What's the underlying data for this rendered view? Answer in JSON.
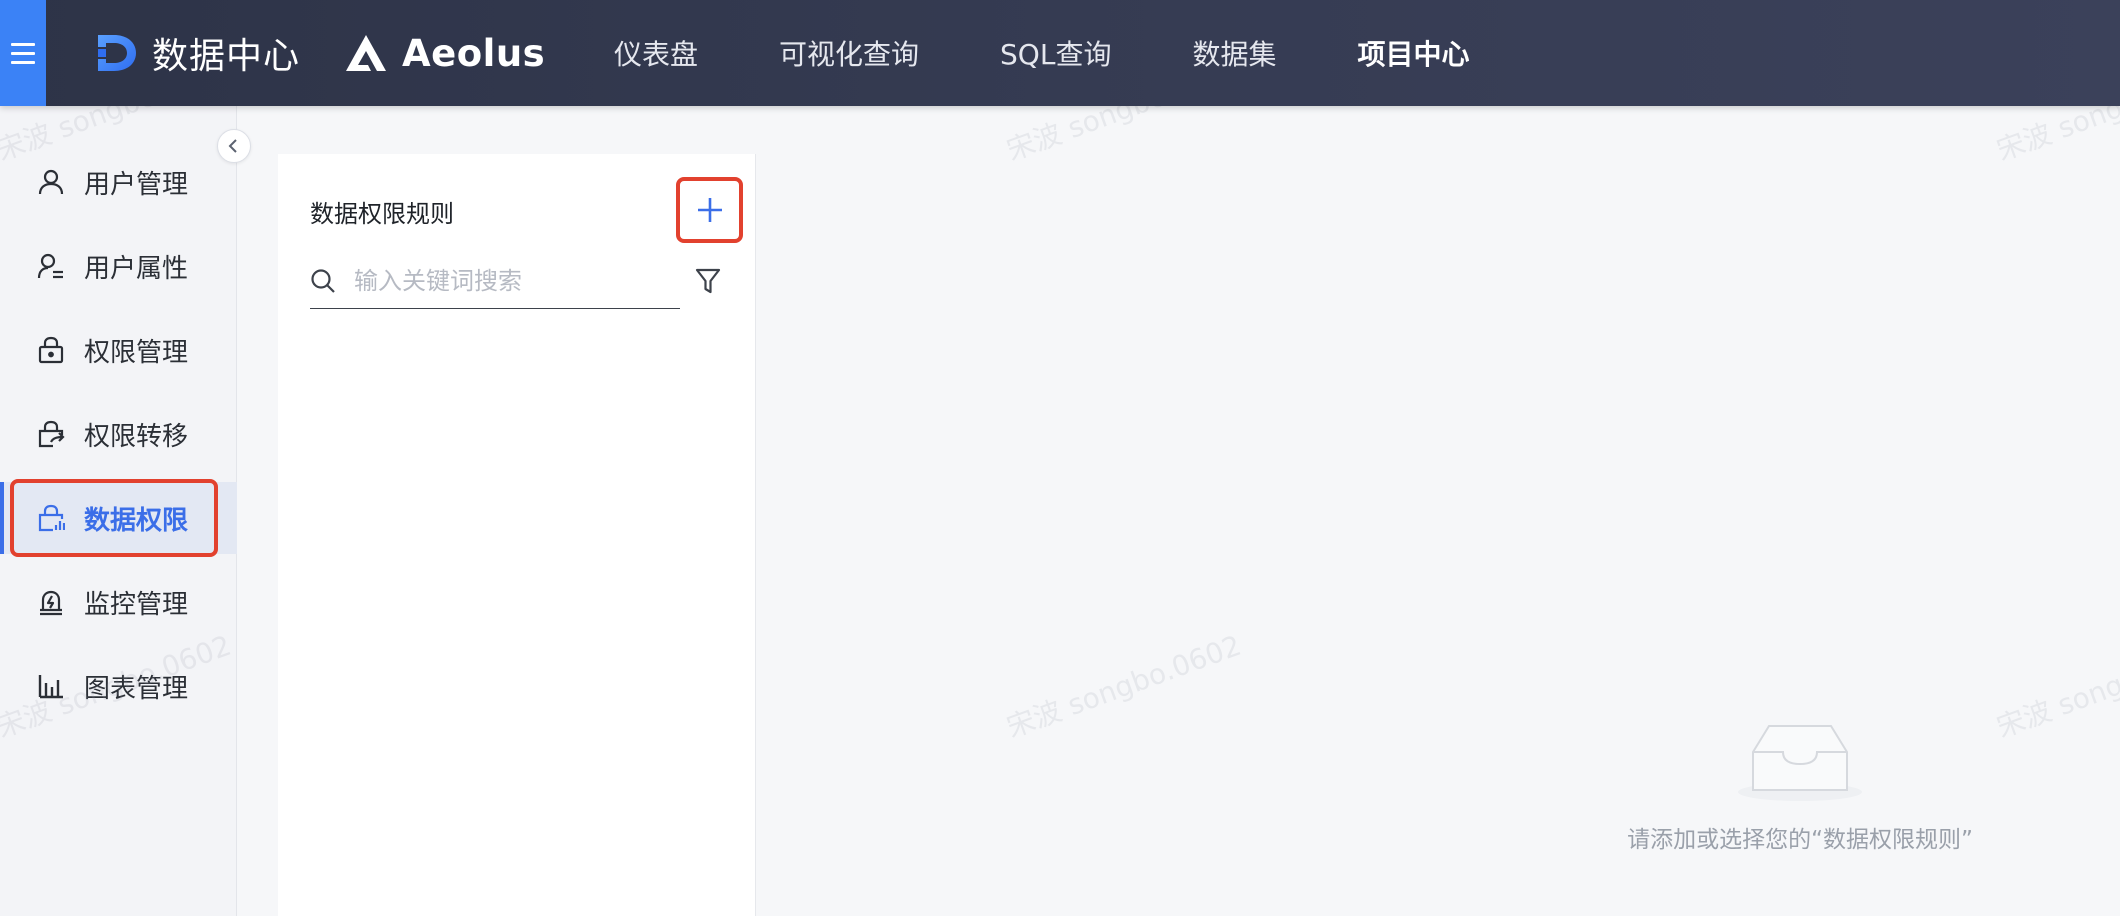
{
  "topbar": {
    "brand_name": "数据中心",
    "product_name": "Aeolus",
    "nav": [
      {
        "label": "仪表盘",
        "active": false
      },
      {
        "label": "可视化查询",
        "active": false
      },
      {
        "label": "SQL查询",
        "active": false
      },
      {
        "label": "数据集",
        "active": false
      },
      {
        "label": "项目中心",
        "active": true
      }
    ],
    "accent_color": "#3b82f6"
  },
  "sidebar": {
    "items": [
      {
        "label": "用户管理",
        "icon": "user-icon",
        "active": false
      },
      {
        "label": "用户属性",
        "icon": "user-attribute-icon",
        "active": false
      },
      {
        "label": "权限管理",
        "icon": "lock-icon",
        "active": false
      },
      {
        "label": "权限转移",
        "icon": "transfer-icon",
        "active": false
      },
      {
        "label": "数据权限",
        "icon": "data-permission-icon",
        "active": true
      },
      {
        "label": "监控管理",
        "icon": "monitor-icon",
        "active": false
      },
      {
        "label": "图表管理",
        "icon": "chart-icon",
        "active": false
      }
    ],
    "active_color": "#3b6ee8"
  },
  "rule_panel": {
    "title": "数据权限规则",
    "search": {
      "placeholder": "输入关键词搜索",
      "value": ""
    }
  },
  "empty_state": {
    "message": "请添加或选择您的“数据权限规则”"
  },
  "watermark": {
    "text": "宋波 songbo.0602"
  },
  "highlight_color": "#e2412e"
}
